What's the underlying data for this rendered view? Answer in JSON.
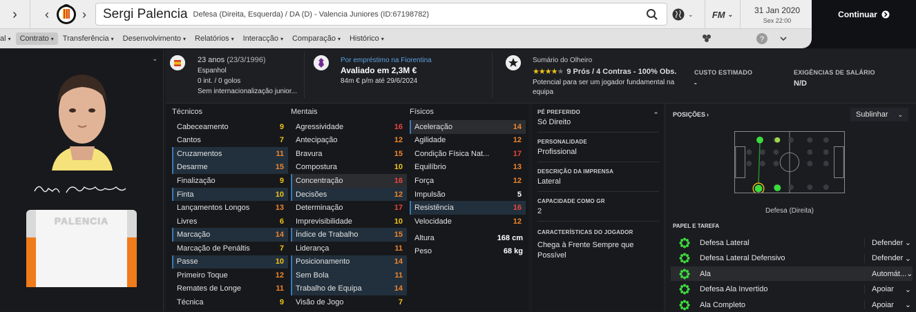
{
  "header": {
    "player_name": "Sergi Palencia",
    "description": "Defesa (Direita, Esquerda) / DA (D) - Valencia Juniores (ID:67198782)",
    "date": "31 Jan 2020",
    "day_time": "Sex 22:00",
    "fm_label": "FM",
    "continue_label": "Continuar"
  },
  "menu": {
    "items": [
      {
        "label": "al"
      },
      {
        "label": "Contrato"
      },
      {
        "label": "Transferência"
      },
      {
        "label": "Desenvolvimento"
      },
      {
        "label": "Relatórios"
      },
      {
        "label": "Interacção"
      },
      {
        "label": "Comparação"
      },
      {
        "label": "Histórico"
      }
    ]
  },
  "profile": {
    "shirt_name": "PALENCIA",
    "signature_alt": "Sergi Palencia"
  },
  "info": {
    "age": "23 anos",
    "dob": "(23/3/1996)",
    "nationality": "Espanhol",
    "caps": "0 int. / 0 golos",
    "intl_status": "Sem internacionalização junior...",
    "loan": "Por empréstimo na Fiorentina",
    "value": "Avaliado em 2,3M €",
    "wage": "84m € p/m até 29/6/2024",
    "scout_title": "Sumário do Olheiro",
    "scout_stars": 4,
    "scout_summary": "9 Prós / 4 Contras - 100% Obs.",
    "scout_potential": "Potencial para ser um jogador fundamental na equipa",
    "cost_label": "CUSTO ESTIMADO",
    "cost_value": "-",
    "salary_label": "EXIGÊNCIAS DE SALÁRIO",
    "salary_value": "N/D"
  },
  "attributes": {
    "technical_title": "Técnicos",
    "mental_title": "Mentais",
    "physical_title": "Físicos",
    "technical": [
      {
        "name": "Cabeceamento",
        "value": 9
      },
      {
        "name": "Cantos",
        "value": 7
      },
      {
        "name": "Cruzamentos",
        "value": 11
      },
      {
        "name": "Desarme",
        "value": 15
      },
      {
        "name": "Finalização",
        "value": 9
      },
      {
        "name": "Finta",
        "value": 10
      },
      {
        "name": "Lançamentos Longos",
        "value": 13
      },
      {
        "name": "Livres",
        "value": 6
      },
      {
        "name": "Marcação",
        "value": 14
      },
      {
        "name": "Marcação de Penáltis",
        "value": 7
      },
      {
        "name": "Passe",
        "value": 10
      },
      {
        "name": "Primeiro Toque",
        "value": 12
      },
      {
        "name": "Remates de Longe",
        "value": 11
      },
      {
        "name": "Técnica",
        "value": 9
      }
    ],
    "mental": [
      {
        "name": "Agressividade",
        "value": 16
      },
      {
        "name": "Antecipação",
        "value": 12
      },
      {
        "name": "Bravura",
        "value": 15
      },
      {
        "name": "Compostura",
        "value": 10
      },
      {
        "name": "Concentração",
        "value": 16
      },
      {
        "name": "Decisões",
        "value": 12
      },
      {
        "name": "Determinação",
        "value": 17
      },
      {
        "name": "Imprevisibilidade",
        "value": 10
      },
      {
        "name": "Índice de Trabalho",
        "value": 15
      },
      {
        "name": "Liderança",
        "value": 11
      },
      {
        "name": "Posicionamento",
        "value": 14
      },
      {
        "name": "Sem Bola",
        "value": 11
      },
      {
        "name": "Trabalho de Equipa",
        "value": 14
      },
      {
        "name": "Visão de Jogo",
        "value": 7
      }
    ],
    "physical": [
      {
        "name": "Aceleração",
        "value": 14
      },
      {
        "name": "Agilidade",
        "value": 12
      },
      {
        "name": "Condição Física Nat...",
        "value": 17
      },
      {
        "name": "Equilíbrio",
        "value": 13
      },
      {
        "name": "Força",
        "value": 12
      },
      {
        "name": "Impulsão",
        "value": 5
      },
      {
        "name": "Resistência",
        "value": 16
      },
      {
        "name": "Velocidade",
        "value": 12
      }
    ],
    "height_label": "Altura",
    "height_value": "168 cm",
    "weight_label": "Peso",
    "weight_value": "68 kg"
  },
  "details": {
    "foot_label": "PÉ PREFERIDO",
    "foot_value": "Só Direito",
    "personality_label": "PERSONALIDADE",
    "personality_value": "Profissional",
    "press_label": "DESCRIÇÃO DA IMPRENSA",
    "press_value": "Lateral",
    "gk_label": "CAPACIDADE COMO GR",
    "gk_value": "2",
    "traits_label": "CARACTERÍSTICAS DO JOGADOR",
    "traits_value": "Chega à Frente Sempre que Possível"
  },
  "positions": {
    "title": "POSIÇÕES",
    "highlight": "Sublinhar",
    "position_name": "Defesa (Direita)",
    "roles_title": "PAPEL E TAREFA",
    "roles": [
      {
        "name": "Defesa Lateral",
        "duty": "Defender"
      },
      {
        "name": "Defesa Lateral Defensivo",
        "duty": "Defender"
      },
      {
        "name": "Ala",
        "duty": "Automát..."
      },
      {
        "name": "Defesa Ala Invertido",
        "duty": "Apoiar"
      },
      {
        "name": "Ala Completo",
        "duty": "Apoiar"
      }
    ]
  },
  "colors": {
    "high": "#e8453c",
    "good": "#f0852d",
    "mid": "#f0c419",
    "low": "#ffffff",
    "accent": "#3c78b5",
    "natural": "#3ddc3d"
  }
}
